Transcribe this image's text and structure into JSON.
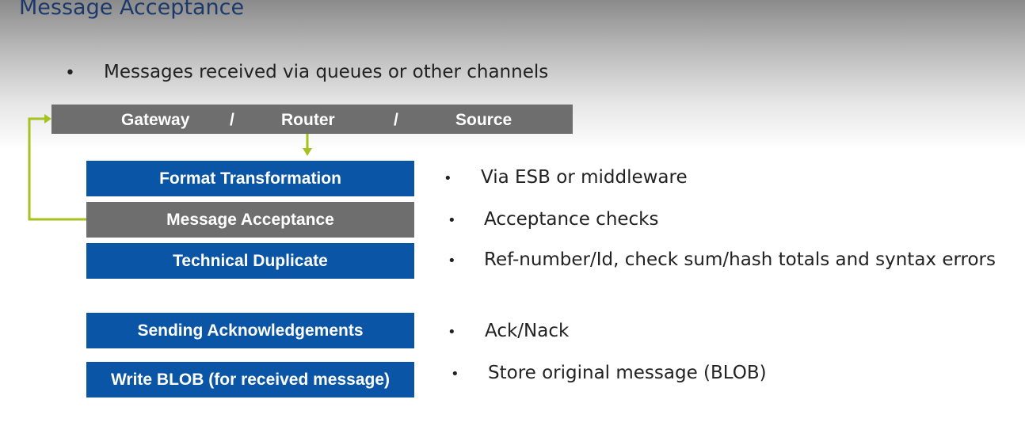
{
  "title": "Message Acceptance",
  "intro": {
    "bullet": "•",
    "text": "Messages received via queues or other channels"
  },
  "gateway_bar": {
    "gateway": "Gateway",
    "sep1": "/",
    "router": "Router",
    "sep2": "/",
    "source": "Source"
  },
  "steps": [
    {
      "label": "Format Transformation",
      "color": "#0a55a5"
    },
    {
      "label": "Message Acceptance",
      "color": "#6e6e6e"
    },
    {
      "label": "Technical Duplicate",
      "color": "#0a55a5"
    },
    {
      "label": "Sending Acknowledgements",
      "color": "#0a55a5"
    },
    {
      "label": "Write BLOB (for received message)",
      "color": "#0a55a5"
    }
  ],
  "notes": [
    {
      "bullet": "•",
      "text": "Via ESB or middleware"
    },
    {
      "bullet": "•",
      "text": "Acceptance checks"
    },
    {
      "bullet": "•",
      "text": "Ref-number/Id, check sum/hash totals and syntax errors"
    },
    {
      "bullet": "•",
      "text": "Ack/Nack"
    },
    {
      "bullet": "•",
      "text": "Store original message (BLOB)"
    }
  ],
  "colors": {
    "title": "#1b3a6b",
    "step_blue": "#0a55a5",
    "step_gray": "#6e6e6e",
    "connector": "#a6c21e"
  }
}
